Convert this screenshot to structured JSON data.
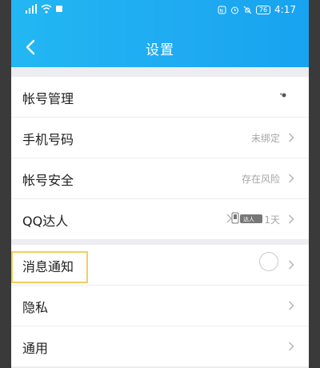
{
  "status_bar": {
    "battery": "76",
    "time": "4:17"
  },
  "navbar": {
    "title": "设置"
  },
  "groups": [
    {
      "items": [
        {
          "label": "帐号管理",
          "value": ""
        },
        {
          "label": "手机号码",
          "value": "未绑定"
        },
        {
          "label": "帐号安全",
          "value": "存在风险"
        },
        {
          "label": "QQ达人",
          "value": "1天",
          "badge_text": "达人"
        }
      ]
    },
    {
      "items": [
        {
          "label": "消息通知",
          "value": ""
        },
        {
          "label": "隐私",
          "value": ""
        },
        {
          "label": "通用",
          "value": ""
        }
      ]
    }
  ],
  "colors": {
    "header_blue": "#1faaf1",
    "highlight_yellow": "#f4cf5c",
    "page_bg": "#ededf1"
  }
}
